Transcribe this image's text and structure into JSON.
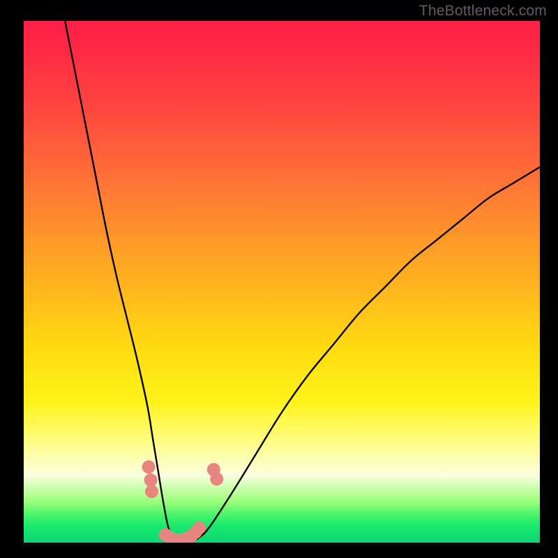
{
  "watermark": "TheBottleneck.com",
  "colors": {
    "frame": "#000000",
    "gradient_top": "#ff1f46",
    "gradient_mid": "#ffe31a",
    "gradient_bottom": "#0cd772",
    "curve": "#000000",
    "markers": "#e98580"
  },
  "chart_data": {
    "type": "line",
    "title": "",
    "xlabel": "",
    "ylabel": "",
    "xlim": [
      0,
      100
    ],
    "ylim": [
      0,
      100
    ],
    "series": [
      {
        "name": "bottleneck-curve",
        "x": [
          8,
          10,
          12,
          14,
          16,
          18,
          20,
          22,
          24,
          25,
          26,
          27,
          28,
          29,
          30,
          32,
          34,
          36,
          40,
          45,
          50,
          55,
          60,
          65,
          70,
          75,
          80,
          85,
          90,
          95,
          100
        ],
        "values": [
          100,
          90,
          80,
          70,
          60,
          51,
          43,
          35,
          26,
          20,
          14,
          8,
          3,
          1,
          0,
          0,
          1,
          3,
          9,
          17,
          25,
          32,
          38,
          44,
          49,
          54,
          58,
          62,
          66,
          69,
          72
        ]
      }
    ],
    "markers": [
      {
        "x": 24.2,
        "y": 14.5
      },
      {
        "x": 24.6,
        "y": 12.0
      },
      {
        "x": 24.8,
        "y": 9.8
      },
      {
        "x": 27.5,
        "y": 1.5
      },
      {
        "x": 28.5,
        "y": 0.8
      },
      {
        "x": 29.5,
        "y": 0.5
      },
      {
        "x": 30.5,
        "y": 0.5
      },
      {
        "x": 31.5,
        "y": 0.8
      },
      {
        "x": 32.5,
        "y": 1.3
      },
      {
        "x": 33.3,
        "y": 2.0
      },
      {
        "x": 34.0,
        "y": 2.8
      },
      {
        "x": 36.8,
        "y": 14.0
      },
      {
        "x": 37.4,
        "y": 12.2
      }
    ]
  }
}
